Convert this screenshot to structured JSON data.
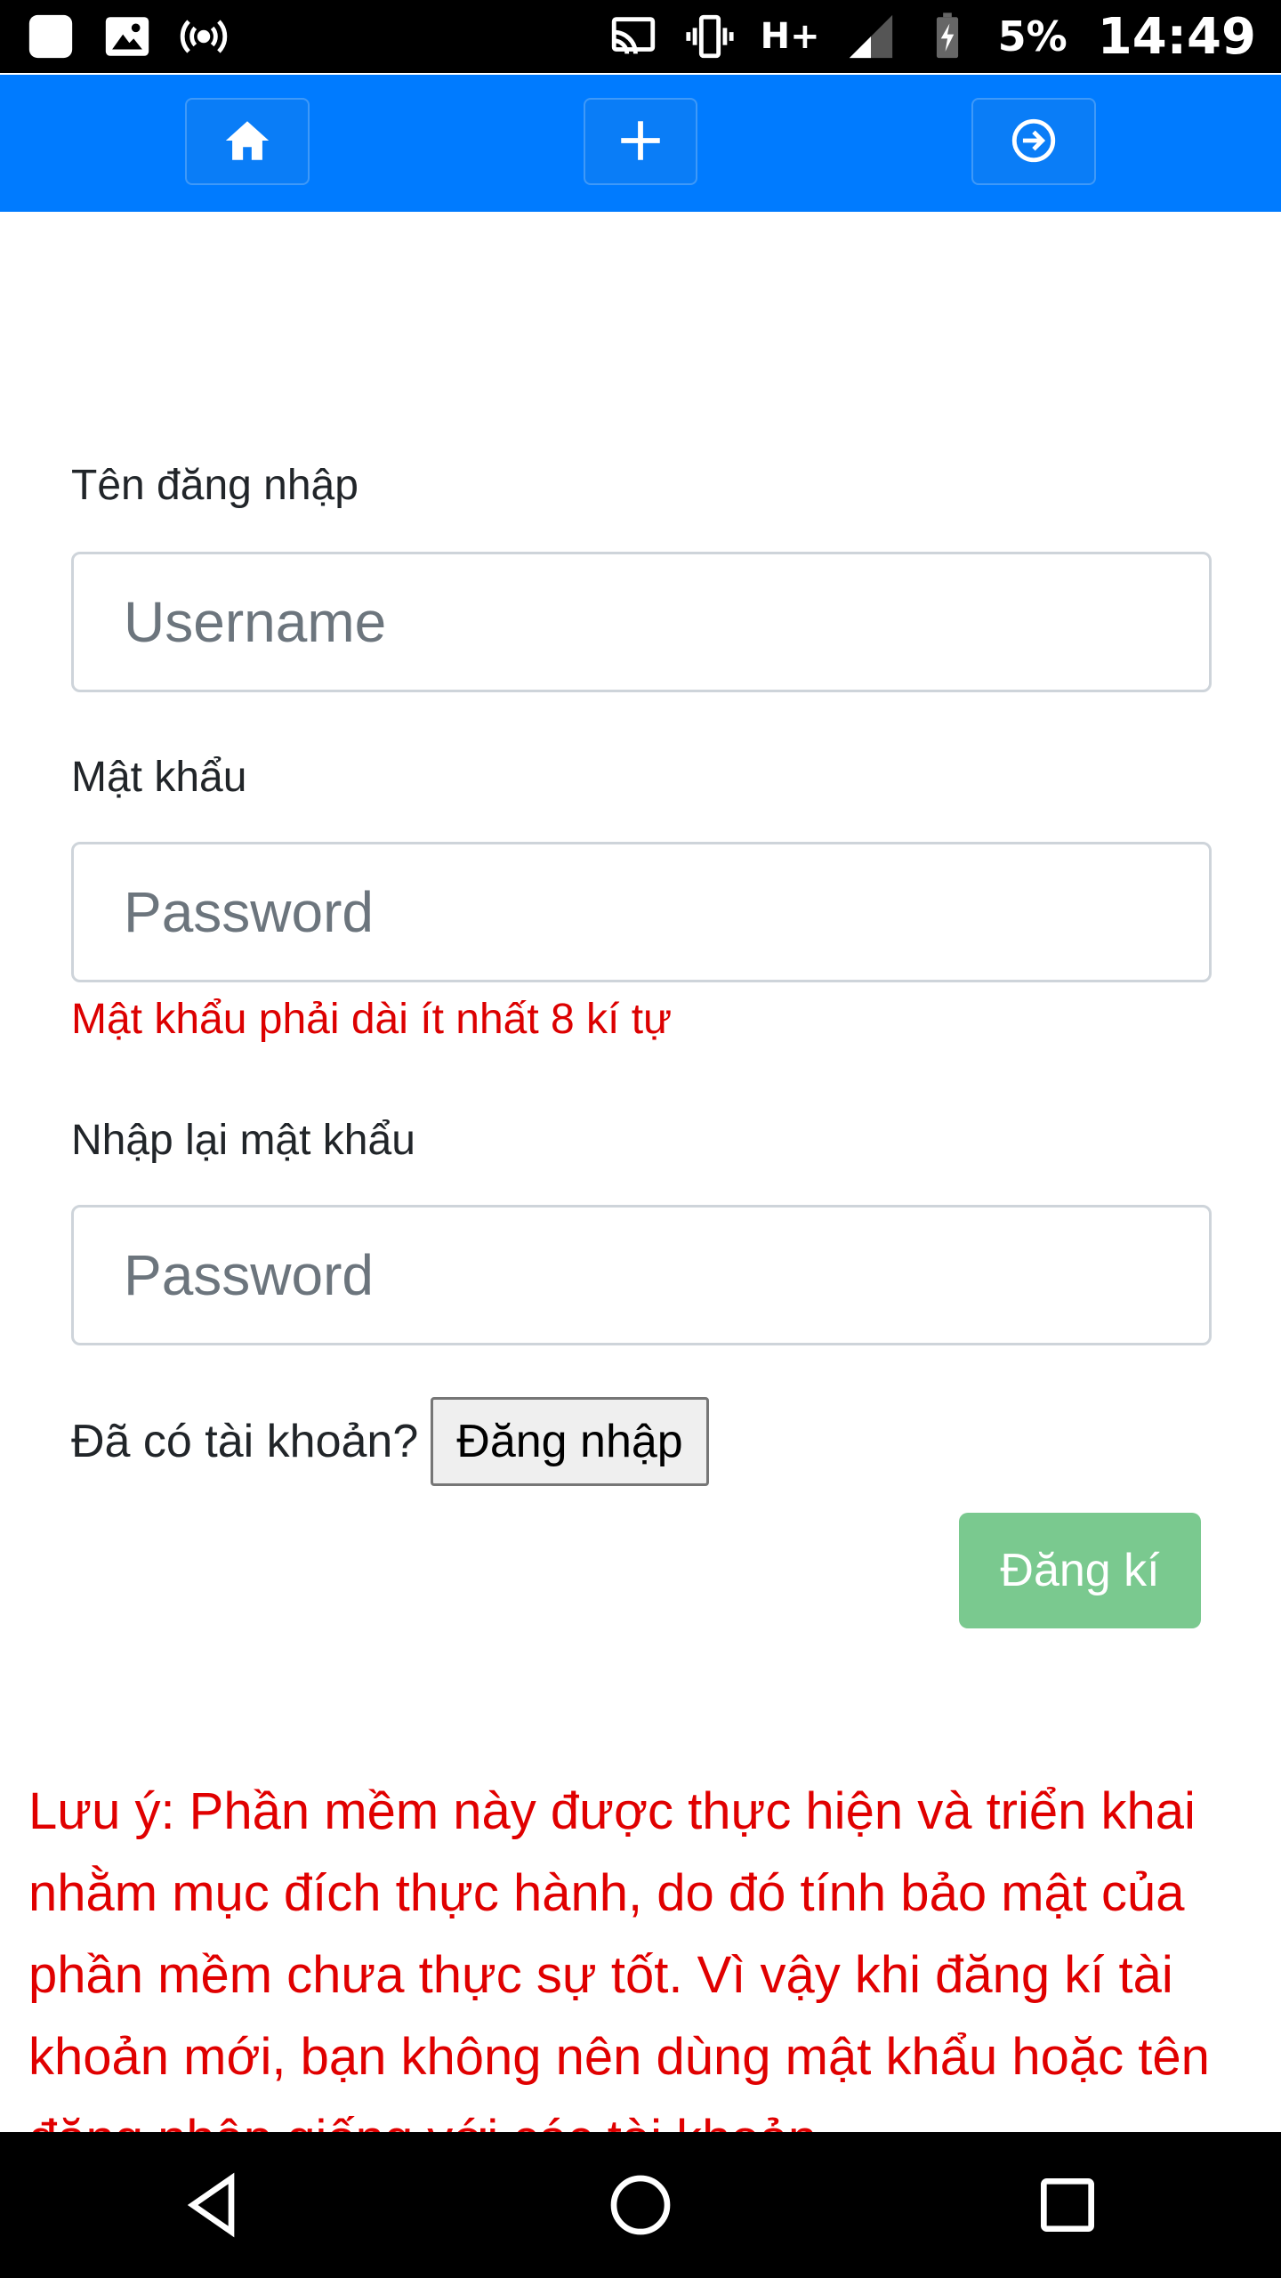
{
  "status_bar": {
    "battery_percent": "5%",
    "time": "14:49",
    "network_type": "H+",
    "icons": [
      "app-icon",
      "image-icon",
      "hotspot-icon",
      "cast-icon",
      "vibrate-icon",
      "network-h-plus-icon",
      "signal-icon",
      "battery-charging-icon"
    ]
  },
  "nav": {
    "icons": [
      "home-icon",
      "plus-icon",
      "sign-in-icon"
    ]
  },
  "form": {
    "username_label": "Tên đăng nhập",
    "username_placeholder": "Username",
    "password_label": "Mật khẩu",
    "password_placeholder": "Password",
    "password_error": "Mật khẩu phải dài ít nhất 8 kí tự",
    "confirm_label": "Nhập lại mật khẩu",
    "confirm_placeholder": "Password",
    "have_account_text": "Đã có tài khoản?",
    "login_button": "Đăng nhập",
    "register_button": "Đăng kí"
  },
  "note": {
    "text": "Lưu ý: Phần mềm này được thực hiện và triển khai nhằm mục đích thực hành, do đó tính bảo mật của phần mềm chưa thực sự tốt. Vì vậy khi đăng kí tài khoản mới, bạn không nên dùng mật khẩu hoặc tên đăng nhập giống với các tài khoản"
  },
  "colors": {
    "nav_blue": "#007bff",
    "error_red": "#dc0000",
    "register_green": "#7ac98f"
  }
}
